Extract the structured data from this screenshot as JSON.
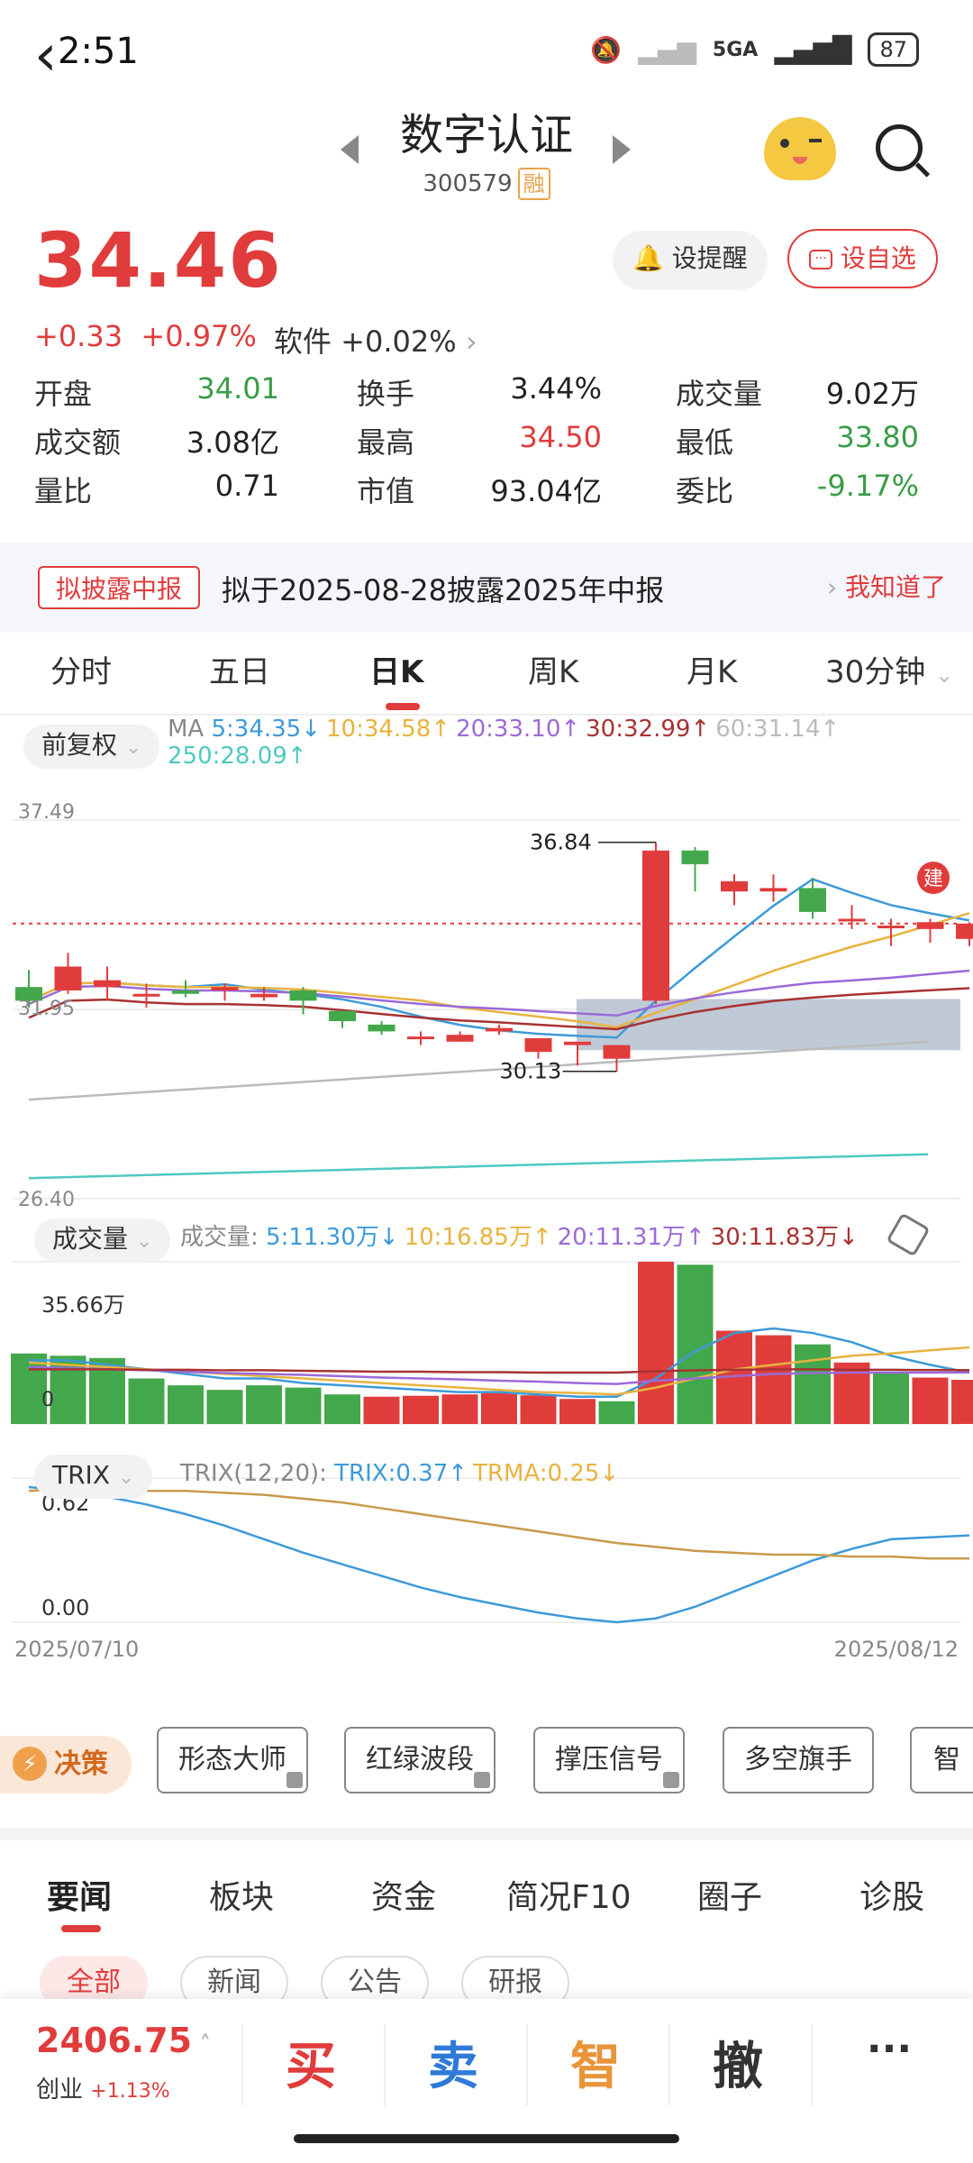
{
  "status": {
    "time": "2:51",
    "network": "5GA",
    "battery": "87"
  },
  "header": {
    "title": "数字认证",
    "code": "300579",
    "margin_tag": "融"
  },
  "quote": {
    "price": "34.46",
    "change": "+0.33",
    "change_pct": "+0.97%",
    "sector": "软件 +0.02%",
    "remind_label": "设提醒",
    "addfav_label": "设自选",
    "fields": [
      {
        "label": "开盘",
        "value": "34.01",
        "color": "green"
      },
      {
        "label": "换手",
        "value": "3.44%",
        "color": "black"
      },
      {
        "label": "成交量",
        "value": "9.02万",
        "color": "black"
      },
      {
        "label": "成交额",
        "value": "3.08亿",
        "color": "black"
      },
      {
        "label": "最高",
        "value": "34.50",
        "color": "red"
      },
      {
        "label": "最低",
        "value": "33.80",
        "color": "green"
      },
      {
        "label": "量比",
        "value": "0.71",
        "color": "black"
      },
      {
        "label": "市值",
        "value": "93.04亿",
        "color": "black"
      },
      {
        "label": "委比",
        "value": "-9.17%",
        "color": "green"
      }
    ]
  },
  "notice": {
    "tag": "拟披露中报",
    "text": "拟于2025-08-28披露2025年中报",
    "action": "我知道了"
  },
  "tabs": [
    "分时",
    "五日",
    "日K",
    "周K",
    "月K",
    "30分钟"
  ],
  "chart_controls": {
    "adjust": "前复权",
    "ma_title": "MA",
    "ma_items": [
      {
        "text": "5:34.35↓",
        "color": "#3d9ad8"
      },
      {
        "text": "10:34.58↑",
        "color": "#e8b340"
      },
      {
        "text": "20:33.10↑",
        "color": "#9b6ad8"
      },
      {
        "text": "30:32.99↑",
        "color": "#a83232"
      },
      {
        "text": "60:31.14↑",
        "color": "#bbbbbb"
      }
    ],
    "ma250": {
      "text": "250:28.09↑",
      "color": "#4ec9c0"
    },
    "vol_chip": "成交量",
    "vol_title": "成交量:",
    "vol_items": [
      {
        "text": "5:11.30万↓",
        "color": "#3d9ad8"
      },
      {
        "text": "10:16.85万↑",
        "color": "#e8b340"
      },
      {
        "text": "20:11.31万↑",
        "color": "#9b6ad8"
      },
      {
        "text": "30:11.83万↓",
        "color": "#a83232"
      }
    ],
    "trix_chip": "TRIX",
    "trix_title": "TRIX(12,20):",
    "trix_items": [
      {
        "text": "TRIX:0.37↑",
        "color": "#3d9ad8"
      },
      {
        "text": "TRMA:0.25↓",
        "color": "#e8b340"
      }
    ]
  },
  "chart_data": {
    "type": "candlestick",
    "y_top_label": "37.49",
    "y_mid_label": "31.95",
    "y_bottom_label": "26.40",
    "ylim": [
      26.4,
      37.49
    ],
    "max_label": "36.84",
    "min_label": "30.13",
    "build_marker": "建",
    "candles": [
      {
        "o": 32.6,
        "c": 32.2,
        "h": 33.1,
        "l": 32.0
      },
      {
        "o": 32.5,
        "c": 33.2,
        "h": 33.6,
        "l": 32.4
      },
      {
        "o": 32.6,
        "c": 32.8,
        "h": 33.2,
        "l": 32.2
      },
      {
        "o": 32.4,
        "c": 32.4,
        "h": 32.7,
        "l": 32.0
      },
      {
        "o": 32.5,
        "c": 32.4,
        "h": 32.8,
        "l": 32.3
      },
      {
        "o": 32.5,
        "c": 32.6,
        "h": 32.7,
        "l": 32.2
      },
      {
        "o": 32.3,
        "c": 32.4,
        "h": 32.6,
        "l": 32.2
      },
      {
        "o": 32.5,
        "c": 32.2,
        "h": 32.6,
        "l": 31.8
      },
      {
        "o": 31.9,
        "c": 31.6,
        "h": 31.9,
        "l": 31.4
      },
      {
        "o": 31.5,
        "c": 31.3,
        "h": 31.6,
        "l": 31.2
      },
      {
        "o": 31.1,
        "c": 31.15,
        "h": 31.3,
        "l": 30.9
      },
      {
        "o": 31.0,
        "c": 31.2,
        "h": 31.3,
        "l": 31.0
      },
      {
        "o": 31.3,
        "c": 31.4,
        "h": 31.5,
        "l": 31.2
      },
      {
        "o": 30.7,
        "c": 31.1,
        "h": 31.1,
        "l": 30.5
      },
      {
        "o": 30.9,
        "c": 31.0,
        "h": 31.0,
        "l": 30.3
      },
      {
        "o": 30.5,
        "c": 30.9,
        "h": 30.9,
        "l": 30.13
      },
      {
        "o": 32.2,
        "c": 36.6,
        "h": 36.84,
        "l": 32.1
      },
      {
        "o": 36.6,
        "c": 36.2,
        "h": 36.7,
        "l": 35.4
      },
      {
        "o": 35.4,
        "c": 35.7,
        "h": 35.9,
        "l": 35.0
      },
      {
        "o": 35.4,
        "c": 35.5,
        "h": 35.9,
        "l": 35.1
      },
      {
        "o": 35.5,
        "c": 34.8,
        "h": 35.8,
        "l": 34.6
      },
      {
        "o": 34.6,
        "c": 34.6,
        "h": 35.0,
        "l": 34.3
      },
      {
        "o": 34.4,
        "c": 34.4,
        "h": 34.6,
        "l": 33.8
      },
      {
        "o": 34.3,
        "c": 34.5,
        "h": 34.6,
        "l": 33.9
      },
      {
        "o": 34.01,
        "c": 34.46,
        "h": 34.5,
        "l": 33.8
      }
    ],
    "volume_label": "35.66万",
    "volume_zero": "0",
    "volumes": [
      {
        "v": 15.5,
        "up": false
      },
      {
        "v": 15.0,
        "up": false
      },
      {
        "v": 14.5,
        "up": false
      },
      {
        "v": 10.0,
        "up": false
      },
      {
        "v": 8.5,
        "up": false
      },
      {
        "v": 7.5,
        "up": false
      },
      {
        "v": 8.5,
        "up": false
      },
      {
        "v": 8.0,
        "up": false
      },
      {
        "v": 6.5,
        "up": false
      },
      {
        "v": 6.0,
        "up": true
      },
      {
        "v": 6.2,
        "up": true
      },
      {
        "v": 6.5,
        "up": true
      },
      {
        "v": 6.8,
        "up": true
      },
      {
        "v": 6.3,
        "up": true
      },
      {
        "v": 5.5,
        "up": true
      },
      {
        "v": 5.0,
        "up": false
      },
      {
        "v": 35.66,
        "up": true
      },
      {
        "v": 35.0,
        "up": false
      },
      {
        "v": 20.5,
        "up": true
      },
      {
        "v": 19.5,
        "up": true
      },
      {
        "v": 17.5,
        "up": false
      },
      {
        "v": 13.5,
        "up": true
      },
      {
        "v": 11.5,
        "up": false
      },
      {
        "v": 10.2,
        "up": true
      },
      {
        "v": 9.7,
        "up": true
      }
    ],
    "trix_top": "0.62",
    "trix_bottom": "0.00",
    "date_start": "2025/07/10",
    "date_end": "2025/08/12"
  },
  "tools": {
    "decide": "决策",
    "items": [
      "形态大师",
      "红绿波段",
      "撑压信号",
      "多空旗手",
      "智能"
    ]
  },
  "news_tabs": [
    "要闻",
    "板块",
    "资金",
    "简况F10",
    "圈子",
    "诊股"
  ],
  "news_sub": [
    "全部",
    "新闻",
    "公告",
    "研报"
  ],
  "bottom": {
    "index_value": "2406.75",
    "index_name": "创业",
    "index_change": "+1.13%",
    "buy": "买",
    "sell": "卖",
    "smart": "智",
    "cancel": "撤",
    "more": "···"
  }
}
